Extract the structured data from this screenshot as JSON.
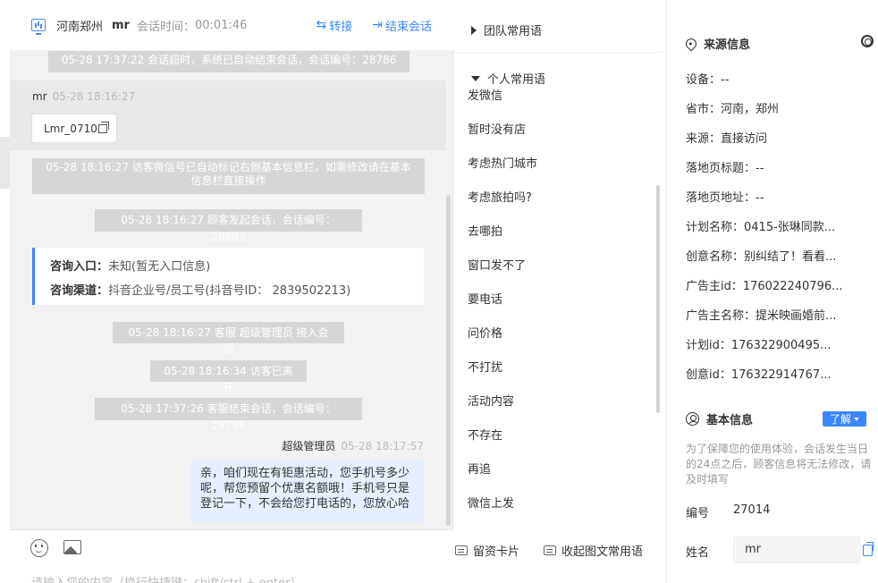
{
  "header": {
    "location": "河南郑州",
    "visitor_name": "mr",
    "session_time_label": "会话时间：",
    "session_time": "00:01:46",
    "transfer_label": "转接",
    "end_label": "结束会话"
  },
  "chat": {
    "sys_top": "05-28 17:37:22 会话超时，系统已自动结束会话，会话编号：28786",
    "visitor_msg": {
      "name": "mr",
      "time": "05-28 18:16:27",
      "text": "Lmr_0710"
    },
    "sys_wechat": "05-28 18:16:27 访客微信号已自动标记右侧基本信息栏，如需修改请在基本信息栏直接操作",
    "sys_start": "05-28 18:16:27 顾客发起会话，会话编号：28803",
    "info_card": {
      "entry_label": "咨询入口：",
      "entry_value": "未知(暂无入口信息)",
      "channel_label": "咨询渠道：",
      "channel_value": "抖音企业号/员工号(抖音号ID： 2839502213)"
    },
    "sys_join": "05-28 18:16:27 客服 超级管理员 接入会话",
    "sys_left": "05-28 18:16:34 访客已离开",
    "sys_end": "05-28 17:37:26 客服结束会话，会话编号：28786",
    "agent_msg": {
      "name": "超级管理员",
      "time": "05-28 18:17:57",
      "text": "亲，咱们现在有钜惠活动，您手机号多少呢，帮您预留个优惠名额哦！手机号只是登记一下，不会给您打电话的，您放心哈"
    },
    "input_placeholder": "请输入您的内容（换行快捷键：shift/ctrl + enter）"
  },
  "phrases": {
    "team_group": "团队常用语",
    "personal_group": "个人常用语",
    "items": [
      "发微信",
      "暂时没有店",
      "考虑热门城市",
      "考虑旅拍吗?",
      "去哪拍",
      "窗口发不了",
      "要电话",
      "问价格",
      "不打扰",
      "活动内容",
      "不存在",
      "再追",
      "微信上发"
    ],
    "card_btn": "留资卡片",
    "fav_btn": "收起图文常用语"
  },
  "info": {
    "source_title": "来源信息",
    "fields": [
      "设备：--",
      "省市：河南，郑州",
      "来源：直接访问",
      "落地页标题：--",
      "落地页地址：--",
      "计划名称：0415-张琳同款...",
      "创意名称：别纠结了！看看...",
      "广告主id：176022240796...",
      "广告主名称：提米映画婚前...",
      "计划id：176322900495...",
      "创意id：176322914767..."
    ],
    "basic_title": "基本信息",
    "learn_btn": "了解",
    "notice": "为了保障您的使用体验，会话发生当日的24点之后，顾客信息将无法修改，请及时填写",
    "id_label": "编号",
    "id_value": "27014",
    "name_label": "姓名",
    "name_value": "mr"
  }
}
